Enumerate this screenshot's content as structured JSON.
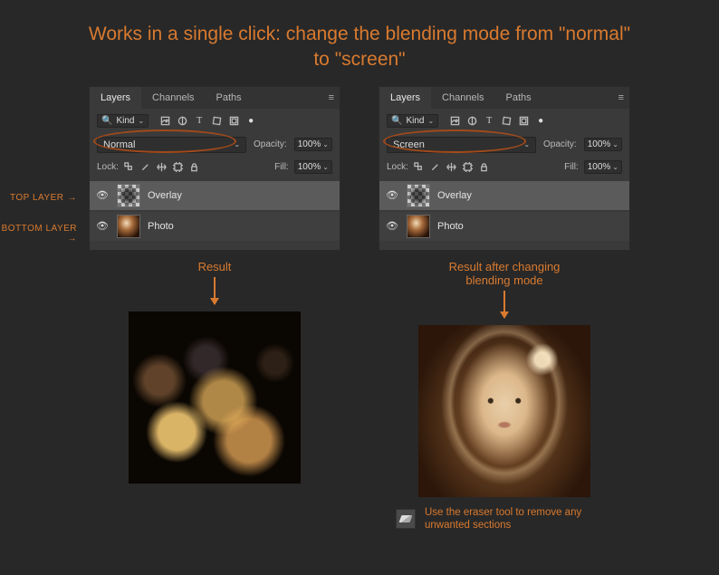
{
  "heading": "Works in a single click: change the blending mode from \"normal\" to \"screen\"",
  "panel": {
    "tabs": {
      "layers": "Layers",
      "channels": "Channels",
      "paths": "Paths"
    },
    "kind_label": "Kind",
    "opacity_label": "Opacity:",
    "opacity_value": "100%",
    "lock_label": "Lock:",
    "fill_label": "Fill:",
    "fill_value": "100%",
    "layer_overlay": "Overlay",
    "layer_photo": "Photo"
  },
  "left": {
    "blend_mode": "Normal",
    "result_label": "Result"
  },
  "right": {
    "blend_mode": "Screen",
    "result_label": "Result after changing blending mode"
  },
  "side_labels": {
    "top": "TOP LAYER",
    "bottom": "BOTTOM LAYER"
  },
  "eraser_note": "Use the eraser tool to remove any unwanted sections"
}
